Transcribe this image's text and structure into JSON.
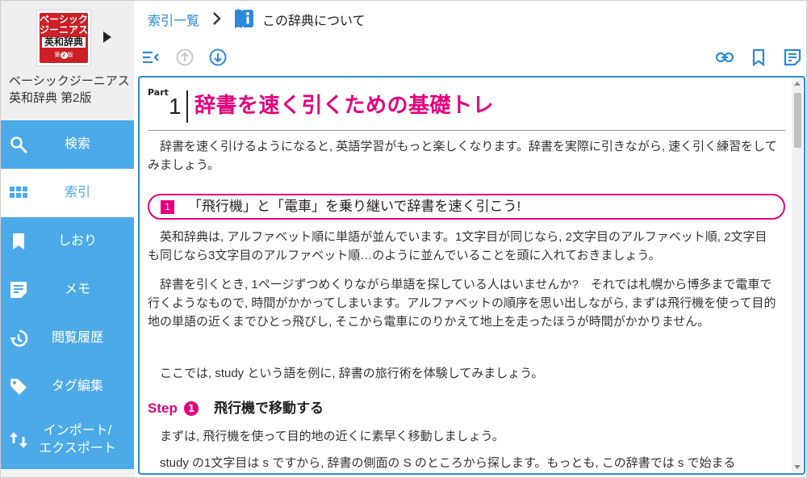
{
  "book": {
    "cover_line1": "ベーシック",
    "cover_line2": "ジーニアス",
    "cover_line3": "英和辞典",
    "cover_edition_pre": "第",
    "cover_edition_num": "2",
    "cover_edition_post": "版",
    "title": "ベーシックジーニアス英和辞典 第2版"
  },
  "sidebar": {
    "items": [
      {
        "label": "検索",
        "icon": "search-icon"
      },
      {
        "label": "索引",
        "icon": "grid-icon"
      },
      {
        "label": "しおり",
        "icon": "bookmark-icon"
      },
      {
        "label": "メモ",
        "icon": "memo-icon"
      },
      {
        "label": "閲覧履歴",
        "icon": "history-icon"
      },
      {
        "label": "タグ編集",
        "icon": "tag-icon"
      },
      {
        "label": "インポート/\nエクスポート",
        "icon": "import-export-icon"
      }
    ]
  },
  "breadcrumb": {
    "parent": "索引一覧",
    "current": "この辞典について"
  },
  "content": {
    "part_label": "Part",
    "part_number": "1",
    "part_title": "辞書を速く引くための基礎トレ",
    "intro": "辞書を速く引けるようになると, 英語学習がもっと楽しくなります。辞書を実際に引きながら, 速く引く練習をしてみましょう。",
    "section_number": "1",
    "section_title": "「飛行機」と「電車」を乗り継いで辞書を速く引こう!",
    "para1": "英和辞典は, アルファベット順に単語が並んでいます。1文字目が同じなら, 2文字目のアルファベット順, 2文字目も同じなら3文字目のアルファベット順…のように並んでいることを頭に入れておきましょう。",
    "para2": "辞書を引くとき, 1ページずつめくりながら単語を探している人はいませんか?　それでは札幌から博多まで電車で行くようなもので, 時間がかかってしまいます。アルファベットの順序を思い出しながら, まずは飛行機を使って目的地の単語の近くまでひとっ飛びし, そこから電車にのりかえて地上を走ったほうが時間がかかりません。",
    "para3": "ここでは, study という語を例に, 辞書の旅行術を体験してみましょう。",
    "step_label": "Step",
    "step_number": "1",
    "step_title": "飛行機で移動する",
    "para4": "まずは, 飛行機を使って目的地の近くに素早く移動しましょう。",
    "para5": "study の1文字目は s ですから, 辞書の側面の S のところから探します。もっとも, この辞書では s で始まる"
  },
  "colors": {
    "accent_blue": "#4daae8",
    "link_blue": "#2a8ad9",
    "magenta": "#e6007e",
    "cover_red": "#cc1f26"
  }
}
